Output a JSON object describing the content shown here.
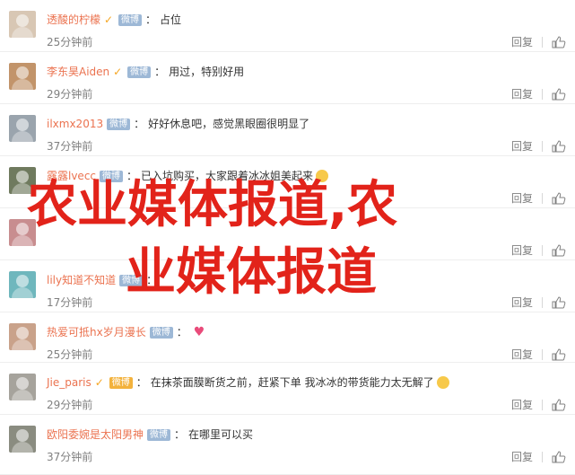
{
  "comments": [
    {
      "user": "透酸的柠檬",
      "badge": "v",
      "vip": "",
      "text": "占位",
      "time": "25分钟前",
      "emoji": "",
      "avatar_color": "#d8c7b4"
    },
    {
      "user": "李东昊Aiden",
      "badge": "v",
      "vip": "",
      "text": "用过，特别好用",
      "time": "29分钟前",
      "emoji": "",
      "avatar_color": "#c2946a"
    },
    {
      "user": "ilxmx2013",
      "badge": "",
      "vip": "",
      "text": "好好休息吧，感觉黑眼圈很明显了",
      "time": "37分钟前",
      "emoji": "",
      "avatar_color": "#9aa4ad"
    },
    {
      "user": "露露lvecc",
      "badge": "",
      "vip": "",
      "text": "已入坑购买，大家跟着冰冰姐美起来",
      "time": "",
      "emoji": "grin",
      "avatar_color": "#6f7a5e"
    },
    {
      "user": "",
      "badge": "",
      "vip": "",
      "text": "",
      "time": "",
      "emoji": "",
      "avatar_color": "#c88d8f"
    },
    {
      "user": "lily知道不知道",
      "badge": "",
      "vip": "",
      "text": "",
      "time": "17分钟前",
      "emoji": "",
      "avatar_color": "#6fb7bd"
    },
    {
      "user": "热爱可抵hx岁月漫长",
      "badge": "",
      "vip": "",
      "text": "",
      "time": "25分钟前",
      "emoji": "heart",
      "avatar_color": "#c9a28a"
    },
    {
      "user": "Jie_paris",
      "badge": "v",
      "vip": "gold",
      "text": "在抹茶面膜断货之前，赶紧下单 我冰冰的带货能力太无解了",
      "time": "29分钟前",
      "emoji": "grin",
      "avatar_color": "#a6a39c"
    },
    {
      "user": "欧阳委婉是太阳男神",
      "badge": "",
      "vip": "",
      "text": "在哪里可以买",
      "time": "37分钟前",
      "emoji": "",
      "avatar_color": "#8a8c80"
    }
  ],
  "labels": {
    "reply": "回复",
    "vip": "微博"
  },
  "overlay": {
    "line1": "农业媒体报道,农",
    "line2": "业媒体报道"
  }
}
